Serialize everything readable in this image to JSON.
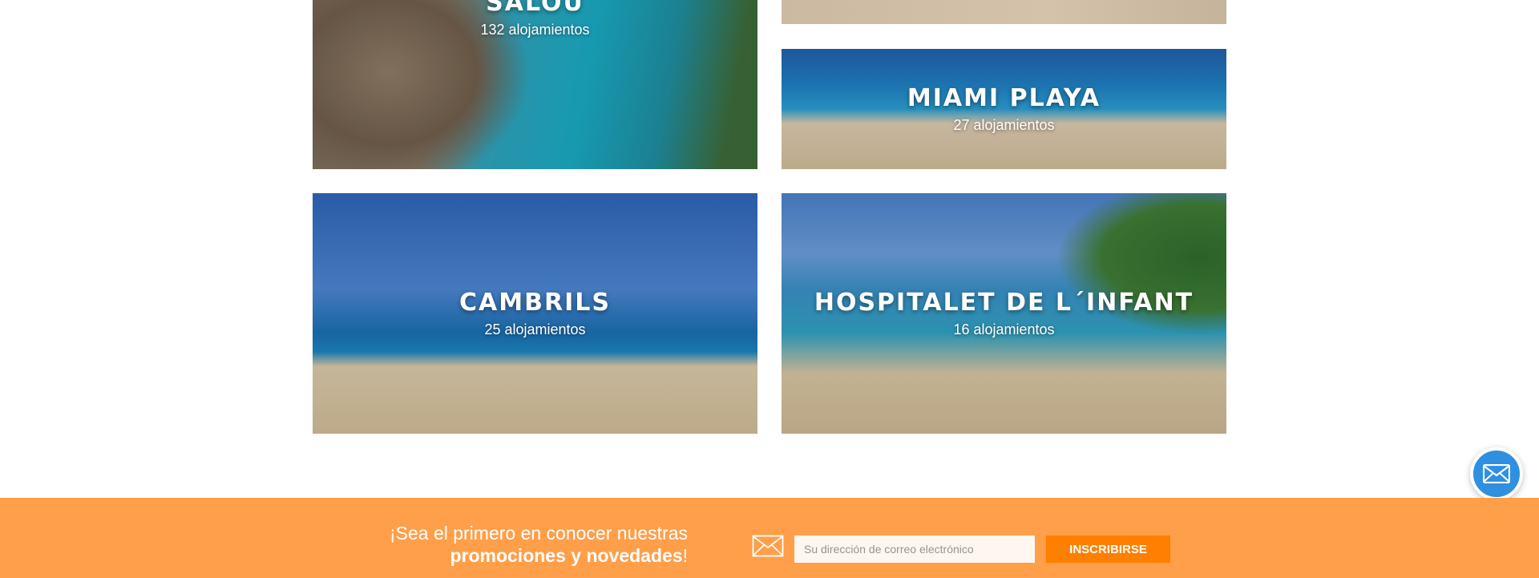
{
  "destinations": [
    {
      "id": "salou",
      "name": "SALOU",
      "count": "132 alojamientos"
    },
    {
      "id": "miami",
      "name": "MIAMI PLAYA",
      "count": "27 alojamientos"
    },
    {
      "id": "cambrils",
      "name": "CAMBRILS",
      "count": "25 alojamientos"
    },
    {
      "id": "hospitalet",
      "name": "HOSPITALET DE L´INFANT",
      "count": "16 alojamientos"
    }
  ],
  "newsletter": {
    "line1": "¡Sea el primero en conocer nuestras",
    "line2_bold": "promociones y novedades",
    "line2_end": "!",
    "email_placeholder": "Su dirección de correo electrónico",
    "subscribe_label": "INSCRIBIRSE"
  },
  "colors": {
    "newsletter_bg": "#ff9f49",
    "button_bg": "#ff7f00",
    "float_button": "#2f8fe0"
  },
  "icons": {
    "newsletter": "envelope-icon",
    "float": "envelope-icon"
  }
}
